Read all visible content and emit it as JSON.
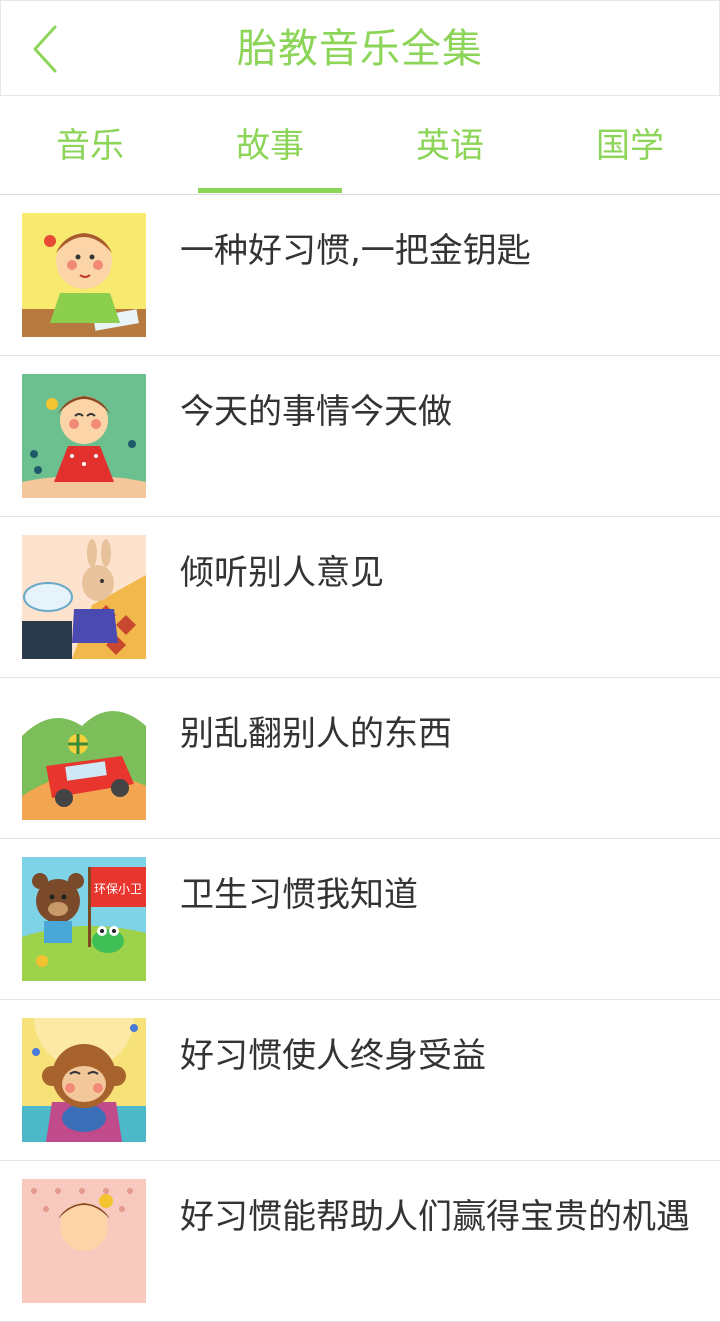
{
  "header": {
    "title": "胎教音乐全集",
    "back_icon": "chevron-left-icon"
  },
  "tabs": [
    {
      "label": "音乐",
      "active": false
    },
    {
      "label": "故事",
      "active": true
    },
    {
      "label": "英语",
      "active": false
    },
    {
      "label": "国学",
      "active": false
    }
  ],
  "stories": [
    {
      "title": "一种好习惯,一把金钥匙",
      "thumb": "girl-at-desk-illustration"
    },
    {
      "title": "今天的事情今天做",
      "thumb": "girl-in-garden-illustration"
    },
    {
      "title": "倾听别人意见",
      "thumb": "rabbit-illustration"
    },
    {
      "title": "别乱翻别人的东西",
      "thumb": "red-car-illustration"
    },
    {
      "title": "卫生习惯我知道",
      "thumb": "bear-and-frog-illustration"
    },
    {
      "title": "好习惯使人终身受益",
      "thumb": "monkey-illustration"
    },
    {
      "title": "好习惯能帮助人们赢得宝贵的机遇",
      "thumb": "girl-on-pink-illustration"
    }
  ],
  "flag_text": "环保小卫",
  "colors": {
    "accent": "#8cd558",
    "text": "#333333",
    "divider": "#e4e4e4"
  }
}
